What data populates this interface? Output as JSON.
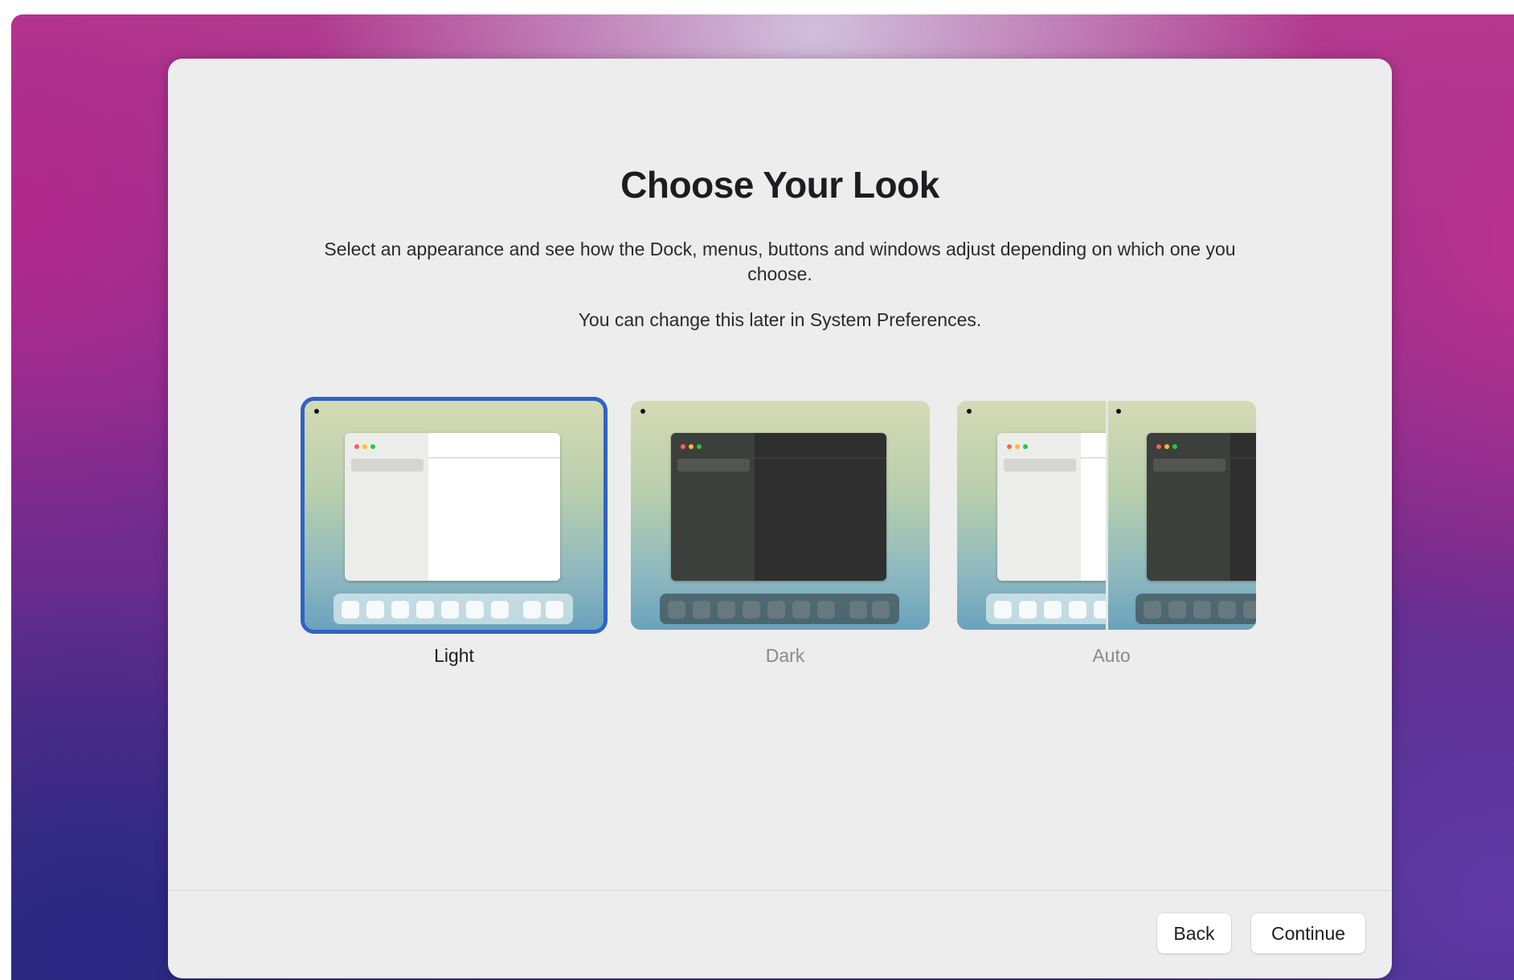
{
  "sheet": {
    "title": "Choose Your Look",
    "description": "Select an appearance and see how the Dock, menus, buttons and windows adjust depending on which one you choose.",
    "note": "You can change this later in System Preferences."
  },
  "appearance_options": [
    {
      "label": "Light",
      "selected": true
    },
    {
      "label": "Dark",
      "selected": false
    },
    {
      "label": "Auto",
      "selected": false
    }
  ],
  "footer": {
    "back_label": "Back",
    "continue_label": "Continue"
  },
  "colors": {
    "selection_accent": "#2f63c4",
    "sheet_background": "#ededed",
    "traffic_light_red": "#ff5f57",
    "traffic_light_yellow": "#febc2e",
    "traffic_light_green": "#28c840"
  }
}
